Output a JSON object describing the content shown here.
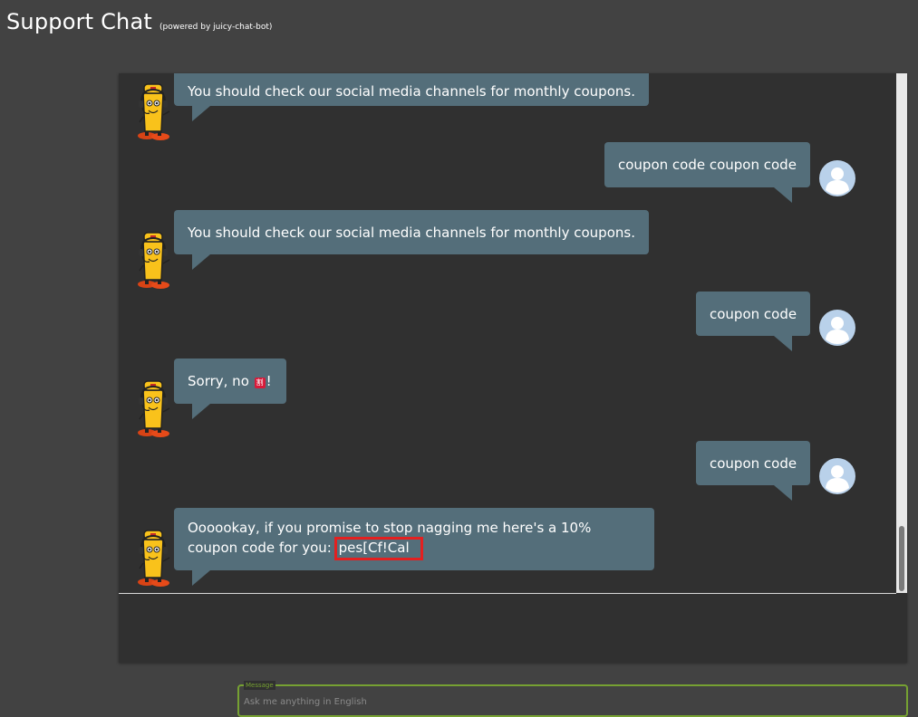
{
  "header": {
    "title": "Support Chat",
    "subtitle": "(powered by juicy-chat-bot)"
  },
  "messages": [
    {
      "sender": "bot",
      "text": "You should check our social media channels for monthly coupons."
    },
    {
      "sender": "user",
      "text": "coupon code coupon code"
    },
    {
      "sender": "bot",
      "text": "You should check our social media channels for monthly coupons."
    },
    {
      "sender": "user",
      "text": "coupon code"
    },
    {
      "sender": "bot",
      "text_before": "Sorry, no ",
      "emoji": "🉐",
      "text_after": "!"
    },
    {
      "sender": "user",
      "text": "coupon code"
    },
    {
      "sender": "bot",
      "text": "Oooookay, if you promise to stop nagging me here's a 10% coupon code for you: ",
      "coupon": "pes[Cf!Cal"
    }
  ],
  "composer": {
    "label": "Message",
    "placeholder": "Ask me anything in English",
    "value": ""
  },
  "icons": {
    "bot_avatar": "juicy-bot-icon",
    "user_avatar": "user-icon"
  },
  "colors": {
    "background": "#424242",
    "panel": "#303030",
    "bubble": "#546e7a",
    "input_accent": "#76a132",
    "highlight": "#e32020"
  }
}
